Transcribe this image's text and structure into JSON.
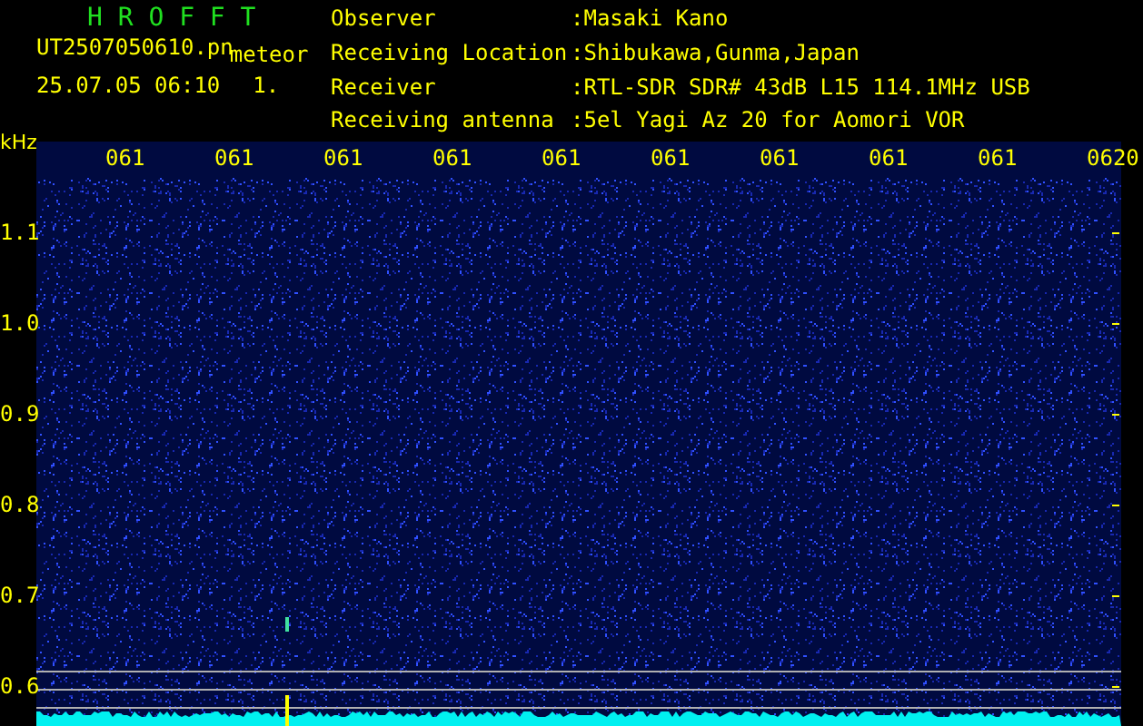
{
  "header": {
    "title": "H R O F F T",
    "filename": "UT2507050610.pn",
    "event_type": "meteor",
    "timestamp": "25.07.05 06:10",
    "count": "1."
  },
  "station_info": [
    {
      "label": "Observer",
      "value": ":Masaki Kano"
    },
    {
      "label": "Receiving Location",
      "value": ":Shibukawa,Gunma,Japan"
    },
    {
      "label": "Receiver",
      "value": ":RTL-SDR SDR# 43dB L15 114.1MHz USB"
    },
    {
      "label": "Receiving antenna",
      "value": ":5el Yagi Az 20 for Aomori VOR"
    }
  ],
  "chart": {
    "y_unit": "kHz",
    "y_labels": [
      "1.1",
      "1.0",
      "0.9",
      "0.8",
      "0.7",
      "0.6"
    ],
    "time_labels": [
      "061",
      "061",
      "061",
      "061",
      "061",
      "061",
      "061",
      "061",
      "061",
      "0620"
    ]
  }
}
